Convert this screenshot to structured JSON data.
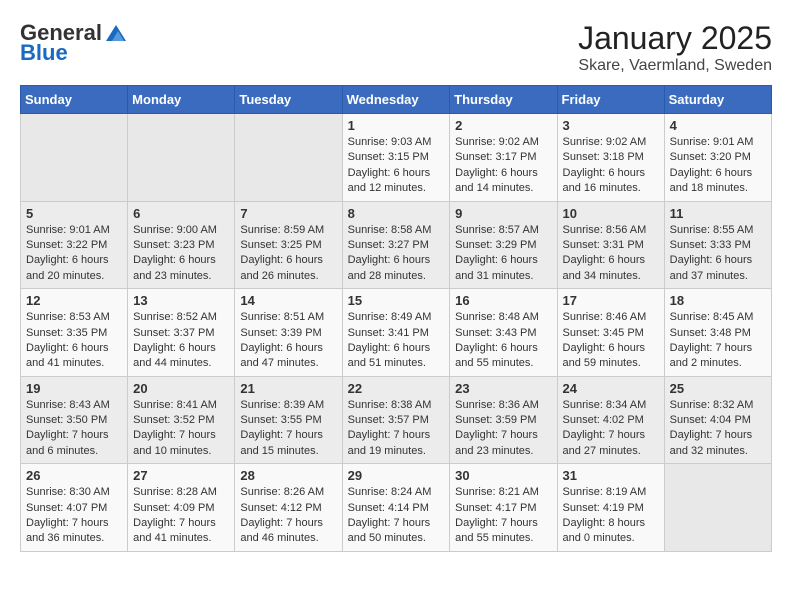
{
  "header": {
    "logo_general": "General",
    "logo_blue": "Blue",
    "title": "January 2025",
    "subtitle": "Skare, Vaermland, Sweden"
  },
  "weekdays": [
    "Sunday",
    "Monday",
    "Tuesday",
    "Wednesday",
    "Thursday",
    "Friday",
    "Saturday"
  ],
  "weeks": [
    [
      {
        "day": "",
        "sunrise": "",
        "sunset": "",
        "daylight": ""
      },
      {
        "day": "",
        "sunrise": "",
        "sunset": "",
        "daylight": ""
      },
      {
        "day": "",
        "sunrise": "",
        "sunset": "",
        "daylight": ""
      },
      {
        "day": "1",
        "sunrise": "Sunrise: 9:03 AM",
        "sunset": "Sunset: 3:15 PM",
        "daylight": "Daylight: 6 hours and 12 minutes."
      },
      {
        "day": "2",
        "sunrise": "Sunrise: 9:02 AM",
        "sunset": "Sunset: 3:17 PM",
        "daylight": "Daylight: 6 hours and 14 minutes."
      },
      {
        "day": "3",
        "sunrise": "Sunrise: 9:02 AM",
        "sunset": "Sunset: 3:18 PM",
        "daylight": "Daylight: 6 hours and 16 minutes."
      },
      {
        "day": "4",
        "sunrise": "Sunrise: 9:01 AM",
        "sunset": "Sunset: 3:20 PM",
        "daylight": "Daylight: 6 hours and 18 minutes."
      }
    ],
    [
      {
        "day": "5",
        "sunrise": "Sunrise: 9:01 AM",
        "sunset": "Sunset: 3:22 PM",
        "daylight": "Daylight: 6 hours and 20 minutes."
      },
      {
        "day": "6",
        "sunrise": "Sunrise: 9:00 AM",
        "sunset": "Sunset: 3:23 PM",
        "daylight": "Daylight: 6 hours and 23 minutes."
      },
      {
        "day": "7",
        "sunrise": "Sunrise: 8:59 AM",
        "sunset": "Sunset: 3:25 PM",
        "daylight": "Daylight: 6 hours and 26 minutes."
      },
      {
        "day": "8",
        "sunrise": "Sunrise: 8:58 AM",
        "sunset": "Sunset: 3:27 PM",
        "daylight": "Daylight: 6 hours and 28 minutes."
      },
      {
        "day": "9",
        "sunrise": "Sunrise: 8:57 AM",
        "sunset": "Sunset: 3:29 PM",
        "daylight": "Daylight: 6 hours and 31 minutes."
      },
      {
        "day": "10",
        "sunrise": "Sunrise: 8:56 AM",
        "sunset": "Sunset: 3:31 PM",
        "daylight": "Daylight: 6 hours and 34 minutes."
      },
      {
        "day": "11",
        "sunrise": "Sunrise: 8:55 AM",
        "sunset": "Sunset: 3:33 PM",
        "daylight": "Daylight: 6 hours and 37 minutes."
      }
    ],
    [
      {
        "day": "12",
        "sunrise": "Sunrise: 8:53 AM",
        "sunset": "Sunset: 3:35 PM",
        "daylight": "Daylight: 6 hours and 41 minutes."
      },
      {
        "day": "13",
        "sunrise": "Sunrise: 8:52 AM",
        "sunset": "Sunset: 3:37 PM",
        "daylight": "Daylight: 6 hours and 44 minutes."
      },
      {
        "day": "14",
        "sunrise": "Sunrise: 8:51 AM",
        "sunset": "Sunset: 3:39 PM",
        "daylight": "Daylight: 6 hours and 47 minutes."
      },
      {
        "day": "15",
        "sunrise": "Sunrise: 8:49 AM",
        "sunset": "Sunset: 3:41 PM",
        "daylight": "Daylight: 6 hours and 51 minutes."
      },
      {
        "day": "16",
        "sunrise": "Sunrise: 8:48 AM",
        "sunset": "Sunset: 3:43 PM",
        "daylight": "Daylight: 6 hours and 55 minutes."
      },
      {
        "day": "17",
        "sunrise": "Sunrise: 8:46 AM",
        "sunset": "Sunset: 3:45 PM",
        "daylight": "Daylight: 6 hours and 59 minutes."
      },
      {
        "day": "18",
        "sunrise": "Sunrise: 8:45 AM",
        "sunset": "Sunset: 3:48 PM",
        "daylight": "Daylight: 7 hours and 2 minutes."
      }
    ],
    [
      {
        "day": "19",
        "sunrise": "Sunrise: 8:43 AM",
        "sunset": "Sunset: 3:50 PM",
        "daylight": "Daylight: 7 hours and 6 minutes."
      },
      {
        "day": "20",
        "sunrise": "Sunrise: 8:41 AM",
        "sunset": "Sunset: 3:52 PM",
        "daylight": "Daylight: 7 hours and 10 minutes."
      },
      {
        "day": "21",
        "sunrise": "Sunrise: 8:39 AM",
        "sunset": "Sunset: 3:55 PM",
        "daylight": "Daylight: 7 hours and 15 minutes."
      },
      {
        "day": "22",
        "sunrise": "Sunrise: 8:38 AM",
        "sunset": "Sunset: 3:57 PM",
        "daylight": "Daylight: 7 hours and 19 minutes."
      },
      {
        "day": "23",
        "sunrise": "Sunrise: 8:36 AM",
        "sunset": "Sunset: 3:59 PM",
        "daylight": "Daylight: 7 hours and 23 minutes."
      },
      {
        "day": "24",
        "sunrise": "Sunrise: 8:34 AM",
        "sunset": "Sunset: 4:02 PM",
        "daylight": "Daylight: 7 hours and 27 minutes."
      },
      {
        "day": "25",
        "sunrise": "Sunrise: 8:32 AM",
        "sunset": "Sunset: 4:04 PM",
        "daylight": "Daylight: 7 hours and 32 minutes."
      }
    ],
    [
      {
        "day": "26",
        "sunrise": "Sunrise: 8:30 AM",
        "sunset": "Sunset: 4:07 PM",
        "daylight": "Daylight: 7 hours and 36 minutes."
      },
      {
        "day": "27",
        "sunrise": "Sunrise: 8:28 AM",
        "sunset": "Sunset: 4:09 PM",
        "daylight": "Daylight: 7 hours and 41 minutes."
      },
      {
        "day": "28",
        "sunrise": "Sunrise: 8:26 AM",
        "sunset": "Sunset: 4:12 PM",
        "daylight": "Daylight: 7 hours and 46 minutes."
      },
      {
        "day": "29",
        "sunrise": "Sunrise: 8:24 AM",
        "sunset": "Sunset: 4:14 PM",
        "daylight": "Daylight: 7 hours and 50 minutes."
      },
      {
        "day": "30",
        "sunrise": "Sunrise: 8:21 AM",
        "sunset": "Sunset: 4:17 PM",
        "daylight": "Daylight: 7 hours and 55 minutes."
      },
      {
        "day": "31",
        "sunrise": "Sunrise: 8:19 AM",
        "sunset": "Sunset: 4:19 PM",
        "daylight": "Daylight: 8 hours and 0 minutes."
      },
      {
        "day": "",
        "sunrise": "",
        "sunset": "",
        "daylight": ""
      }
    ]
  ]
}
